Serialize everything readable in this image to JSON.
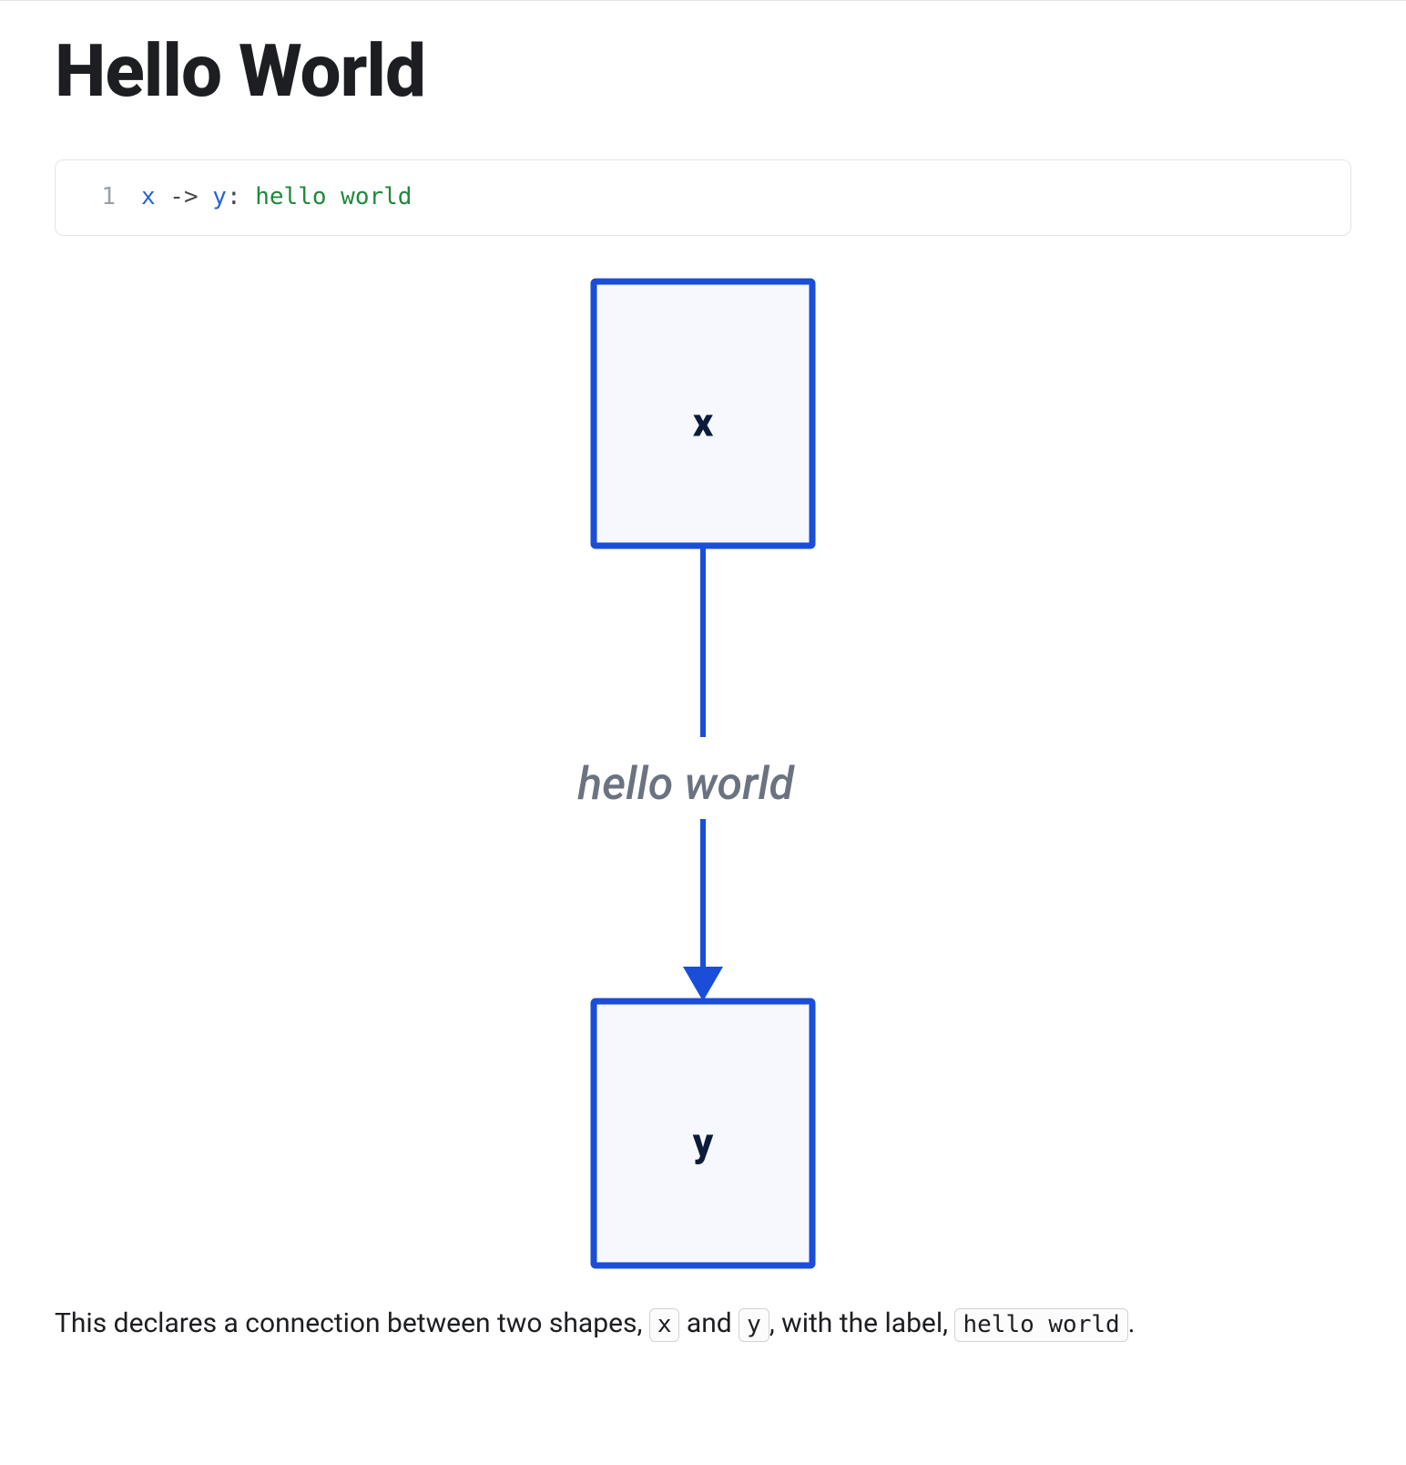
{
  "title": "Hello World",
  "code": {
    "lineno": "1",
    "var1": "x",
    "arrow": " -> ",
    "var2": "y",
    "colon": ": ",
    "label": "hello world"
  },
  "diagram": {
    "node_x_label": "x",
    "node_y_label": "y",
    "edge_label": "hello world",
    "colors": {
      "node_stroke": "#1a4ed8",
      "node_fill": "#f6f8fe",
      "node_text": "#0b1b3a",
      "edge": "#1a4ed8",
      "edge_label": "#6b7280"
    }
  },
  "caption": {
    "t1": "This declares a connection between two shapes, ",
    "c1": "x",
    "t2": " and ",
    "c2": "y",
    "t3": ", with the label, ",
    "c3": "hello world",
    "t4": "."
  }
}
